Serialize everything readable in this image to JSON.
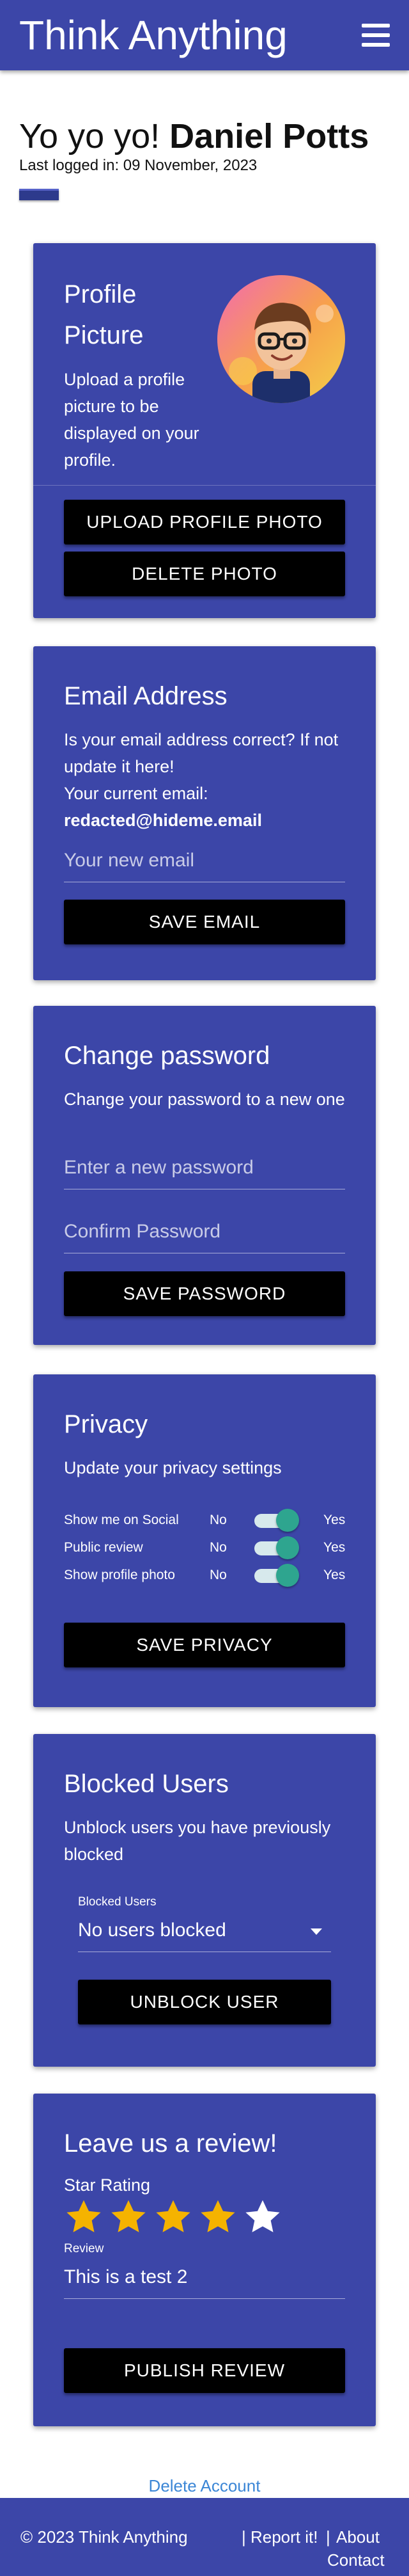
{
  "header": {
    "brand": "Think Anything",
    "menu_icon": "hamburger-menu-icon"
  },
  "greeting": {
    "prefix": "Yo yo yo! ",
    "name": "Daniel Potts",
    "last_logged": "Last logged in: 09 November, 2023"
  },
  "profile": {
    "title_line1": "Profile",
    "title_line2": "Picture",
    "text": "Upload a profile picture to be displayed on your profile.",
    "upload_label": "UPLOAD PROFILE PHOTO",
    "delete_label": "DELETE PHOTO"
  },
  "email": {
    "title": "Email Address",
    "text": "Is your email address correct? If not update it here!",
    "current_label": "Your current email:",
    "current_value": "redacted@hideme.email",
    "placeholder": "Your new email",
    "save_label": "SAVE EMAIL"
  },
  "password": {
    "title": "Change password",
    "text": "Change your password to a new one",
    "new_placeholder": "Enter a new password",
    "confirm_placeholder": "Confirm Password",
    "save_label": "SAVE PASSWORD"
  },
  "privacy": {
    "title": "Privacy",
    "text": "Update your privacy settings",
    "rows": [
      {
        "label": "Show me on Social",
        "no": "No",
        "yes": "Yes",
        "on": true
      },
      {
        "label": "Public review",
        "no": "No",
        "yes": "Yes",
        "on": true
      },
      {
        "label": "Show profile photo",
        "no": "No",
        "yes": "Yes",
        "on": true
      }
    ],
    "save_label": "SAVE PRIVACY"
  },
  "blocked": {
    "title": "Blocked Users",
    "text": "Unblock users you have previously blocked",
    "select_label": "Blocked Users",
    "select_value": "No users blocked",
    "unblock_label": "UNBLOCK USER"
  },
  "review": {
    "title": "Leave us a review!",
    "rating_label": "Star Rating",
    "rating": 4,
    "max_rating": 5,
    "review_label": "Review",
    "review_value": "This is a test 2",
    "publish_label": "PUBLISH REVIEW"
  },
  "delete_account": "Delete Account",
  "footer": {
    "copyright": "© 2023 Think Anything",
    "report": "| Report it!",
    "sep": "|",
    "about": "About",
    "contact": "Contact"
  },
  "colors": {
    "primary": "#3c46a8",
    "button": "#000000",
    "toggle": "#2ea58f",
    "star_filled": "#f5b300",
    "star_empty": "#ffffff",
    "link": "#3b86d6"
  }
}
